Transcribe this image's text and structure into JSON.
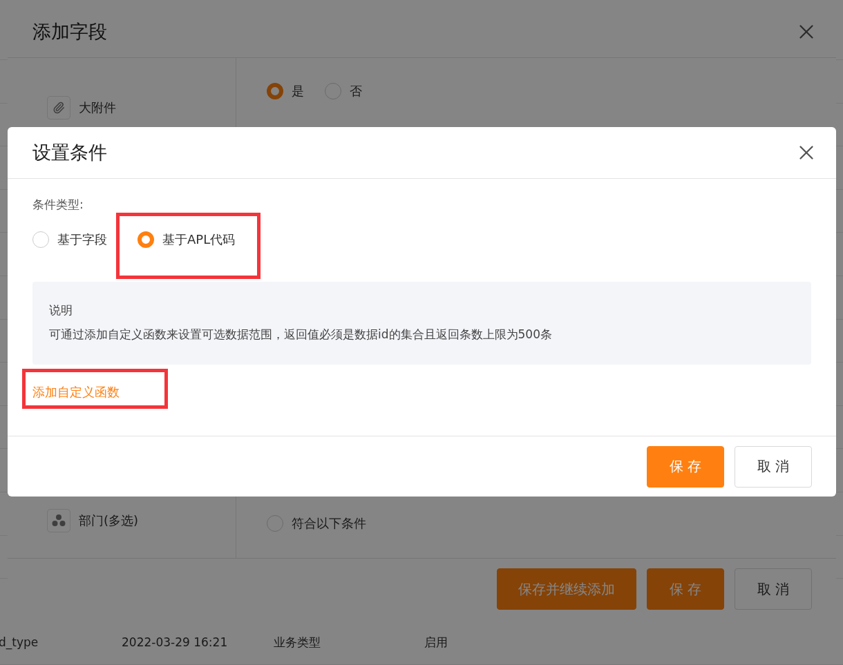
{
  "background_table": {
    "rows": [
      {
        "cells": [
          "d_type",
          "2022-03-29 16:21",
          "业务类型",
          "启用"
        ]
      }
    ]
  },
  "field_dialog": {
    "title": "添加字段",
    "field_types": [
      {
        "label": "大附件",
        "kind": "attachment"
      },
      {
        "label": "部门(多选)",
        "kind": "department"
      }
    ],
    "layout_radios": [
      {
        "label": "是",
        "selected": true
      },
      {
        "label": "否",
        "selected": false
      }
    ],
    "scope_radios": [
      {
        "label": "符合以下条件",
        "selected": false
      }
    ],
    "buttons": [
      {
        "label": "保存并继续添加",
        "kind": "primary"
      },
      {
        "label": "保 存",
        "kind": "primary"
      },
      {
        "label": "取 消",
        "kind": "secondary"
      }
    ]
  },
  "condition_dialog": {
    "title": "设置条件",
    "type_label": "条件类型:",
    "type_radios": [
      {
        "label": "基于字段",
        "selected": false,
        "highlighted": false
      },
      {
        "label": "基于APL代码",
        "selected": true,
        "highlighted": true
      }
    ],
    "note": {
      "title": "说明",
      "text": "可通过添加自定义函数来设置可选数据范围，返回值必须是数据id的集合且返回条数上限为500条"
    },
    "link": {
      "label": "添加自定义函数",
      "highlighted": true
    },
    "buttons": [
      {
        "label": "保 存",
        "kind": "primary"
      },
      {
        "label": "取 消",
        "kind": "secondary"
      }
    ]
  }
}
